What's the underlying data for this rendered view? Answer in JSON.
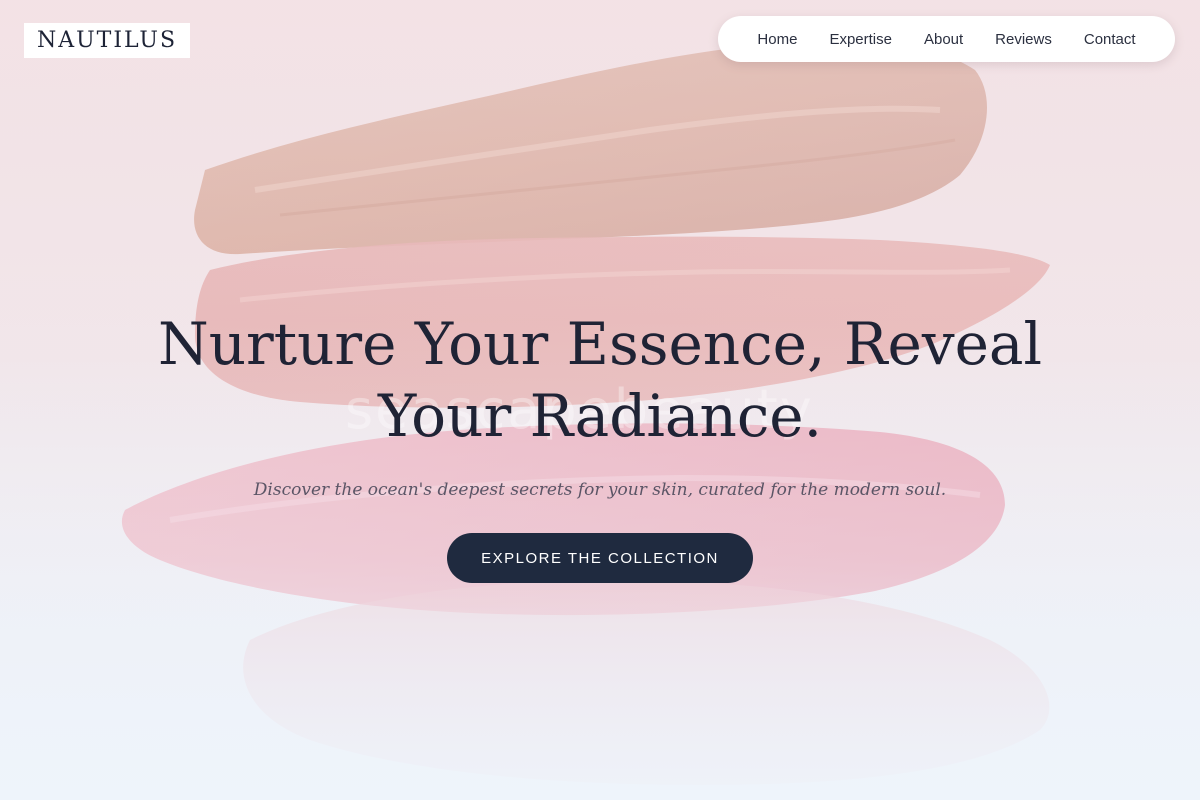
{
  "brand": {
    "name": "NAUTILUS"
  },
  "nav": {
    "items": [
      {
        "label": "Home"
      },
      {
        "label": "Expertise"
      },
      {
        "label": "About"
      },
      {
        "label": "Reviews"
      },
      {
        "label": "Contact"
      }
    ]
  },
  "hero": {
    "headline_line1": "Nurture Your Essence, Reveal",
    "headline_line2": "Your Radiance.",
    "watermark": "seascapebeauty",
    "subtitle": "Discover the ocean's deepest secrets for your skin, curated for the modern soul.",
    "cta_label": "EXPLORE THE COLLECTION"
  },
  "colors": {
    "accent_dark": "#1f2a3f",
    "text_dark": "#1f2335",
    "swatch_beige": "#d8ad9f",
    "swatch_rose": "#e8afae",
    "swatch_pink": "#eca9b9"
  }
}
